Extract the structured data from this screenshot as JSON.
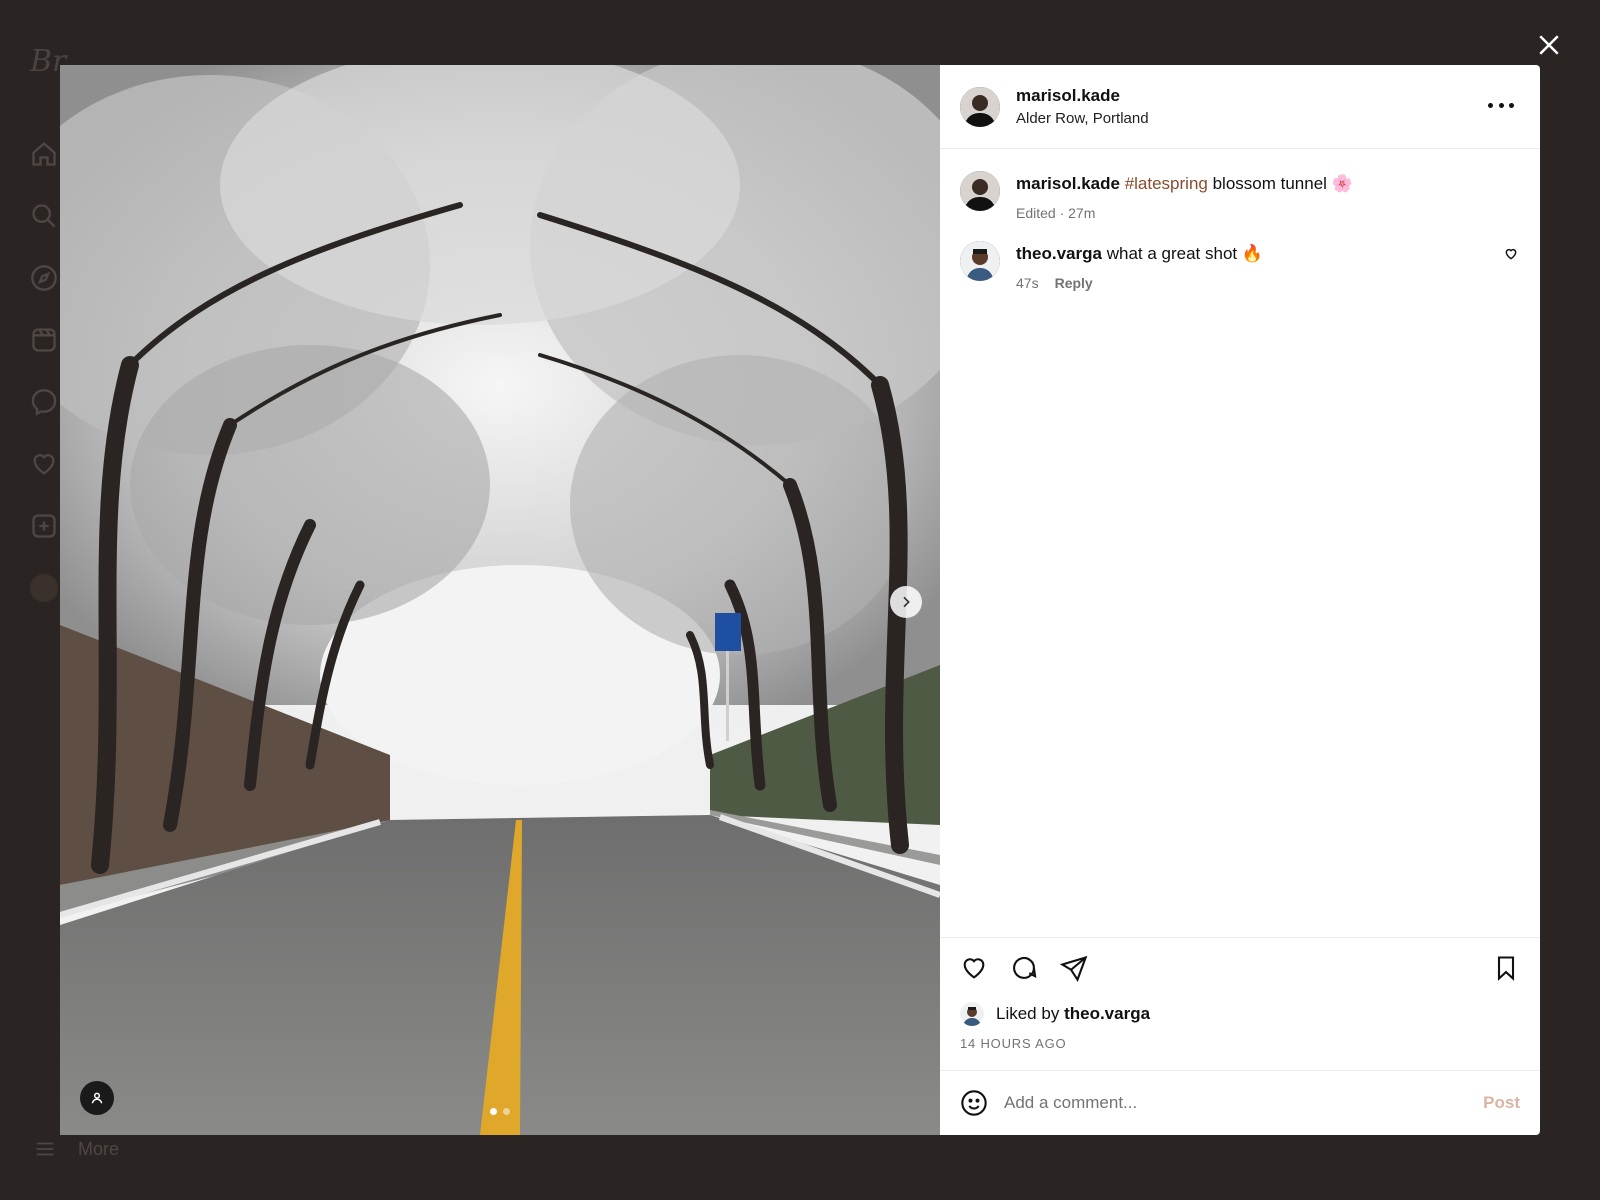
{
  "background": {
    "logo_text": "Br",
    "more_label": "More",
    "nav_icons": [
      "home-icon",
      "search-icon",
      "explore-icon",
      "reels-icon",
      "messenger-icon",
      "heart-icon",
      "create-icon",
      "profile-avatar"
    ]
  },
  "post": {
    "author": "marisol.kade",
    "location": "Alder Row, Portland",
    "caption": {
      "user": "marisol.kade",
      "hashtag": "#latespring",
      "text": "blossom tunnel 🌸",
      "meta": "Edited · 27m"
    },
    "comments": [
      {
        "user": "theo.varga",
        "text": "what a great shot 🔥",
        "time": "47s",
        "reply_label": "Reply"
      }
    ],
    "liked_by_prefix": "Liked by",
    "liked_by_user": "theo.varga",
    "timestamp": "14 HOURS AGO",
    "comment_placeholder": "Add a comment...",
    "post_label": "Post",
    "carousel": {
      "count": 2,
      "active": 0
    }
  },
  "colors": {
    "overlay": "#2a2523",
    "hashtag": "#8a4b2e",
    "post_button_disabled": "#d9b5a3",
    "meta_text": "#737373"
  }
}
